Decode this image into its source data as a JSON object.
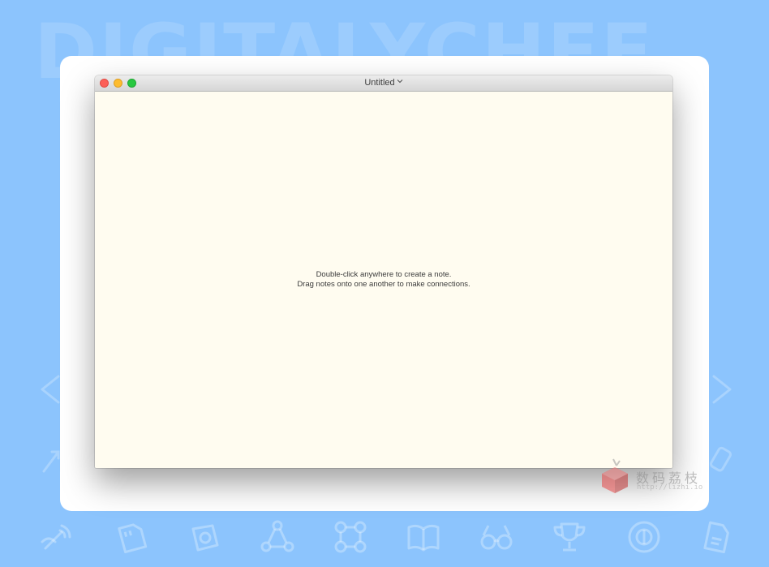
{
  "background": {
    "watermark_text": "DIGITALYCHEF",
    "color": "#8cc4fd",
    "icons": [
      "wifi-hand-icon",
      "sd-card-icon",
      "scale-icon",
      "network-nodes-icon",
      "command-icon",
      "book-icon",
      "glasses-icon",
      "trophy-icon",
      "target-icon",
      "file-icon"
    ]
  },
  "window": {
    "title": "Untitled",
    "title_chevron": "chevron-down-icon",
    "controls": [
      "close",
      "minimize",
      "maximize"
    ],
    "background_color": "#fffcf0"
  },
  "canvas": {
    "hint_line1": "Double-click anywhere to create a note.",
    "hint_line2": "Drag notes onto one another to make connections."
  },
  "logo_watermark": {
    "chinese_text": "数码荔枝",
    "url": "http://lizhi.io"
  }
}
